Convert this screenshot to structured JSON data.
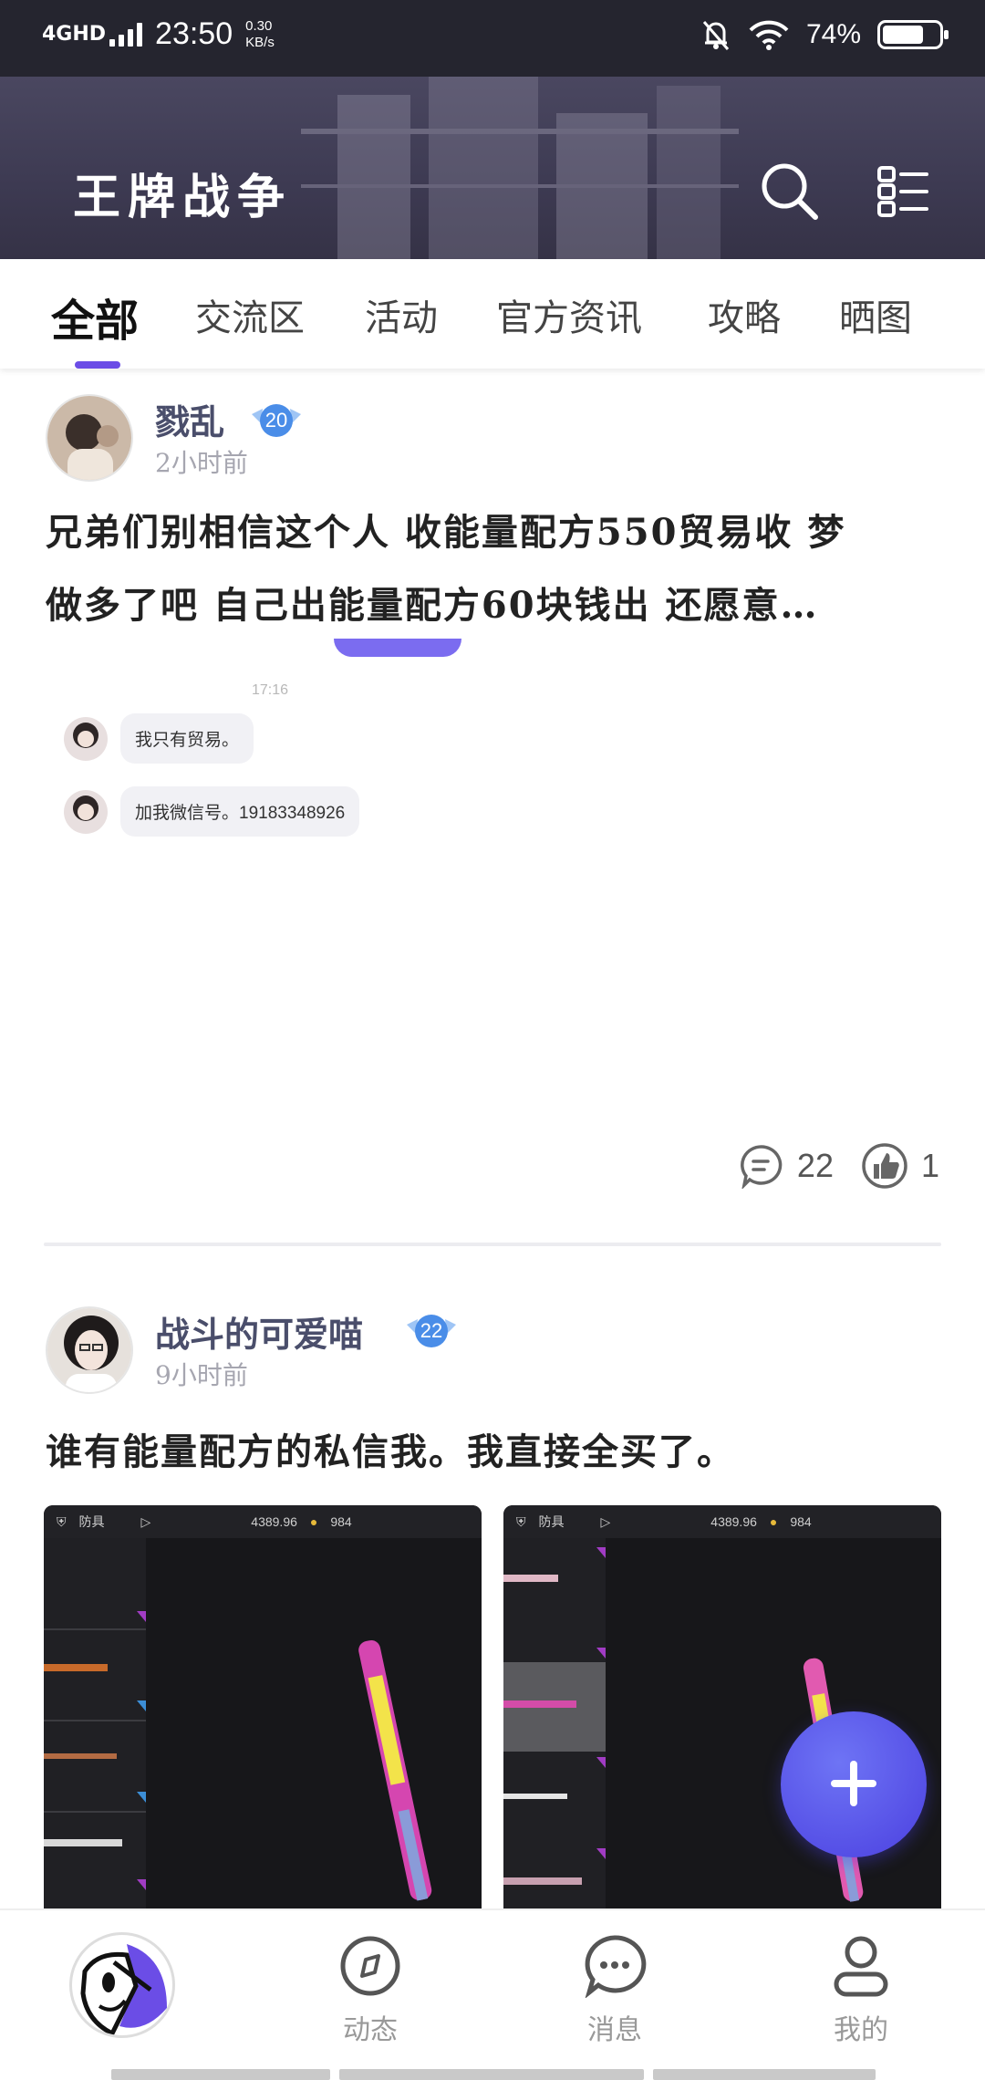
{
  "status_bar": {
    "network": "4GHD",
    "time": "23:50",
    "speed_value": "0.30",
    "speed_unit": "KB/s",
    "battery_percent": "74%",
    "battery_level": 0.74
  },
  "header": {
    "title": "王牌战争",
    "search_icon": "search-icon",
    "menu_icon": "list-menu-icon"
  },
  "tabs": [
    {
      "label": "全部",
      "active": true
    },
    {
      "label": "交流区",
      "active": false
    },
    {
      "label": "活动",
      "active": false
    },
    {
      "label": "官方资讯",
      "active": false
    },
    {
      "label": "攻略",
      "active": false
    },
    {
      "label": "晒图",
      "active": false
    }
  ],
  "posts": [
    {
      "username": "戮乱",
      "level": "20",
      "time": "2小时前",
      "line1": "兄弟们别相信这个人 收能量配方550贸易收 梦",
      "line2": "做多了吧 自己出能量配方60块钱出 还愿意…",
      "chat": {
        "time": "17:16",
        "msg1": "我只有贸易。",
        "msg2": "加我微信号。19183348926"
      },
      "comments": "22",
      "likes": "1"
    },
    {
      "username": "战斗的可爱喵",
      "level": "22",
      "time": "9小时前",
      "line1": "谁有能量配方的私信我。我直接全买了。",
      "images": [
        {
          "tab": "防具",
          "money": "4389.96",
          "coins": "984"
        },
        {
          "tab": "防具",
          "money": "4389.96",
          "coins": "984"
        }
      ]
    }
  ],
  "fab": {
    "icon": "plus-icon"
  },
  "bottom_nav": [
    {
      "label": "",
      "icon": "app-logo-icon"
    },
    {
      "label": "动态",
      "icon": "compass-icon"
    },
    {
      "label": "消息",
      "icon": "chat-bubble-icon"
    },
    {
      "label": "我的",
      "icon": "user-icon"
    }
  ],
  "colors": {
    "accent": "#6b4de6",
    "header_bg": "#3d3a52",
    "fab": "#4b40e0"
  }
}
